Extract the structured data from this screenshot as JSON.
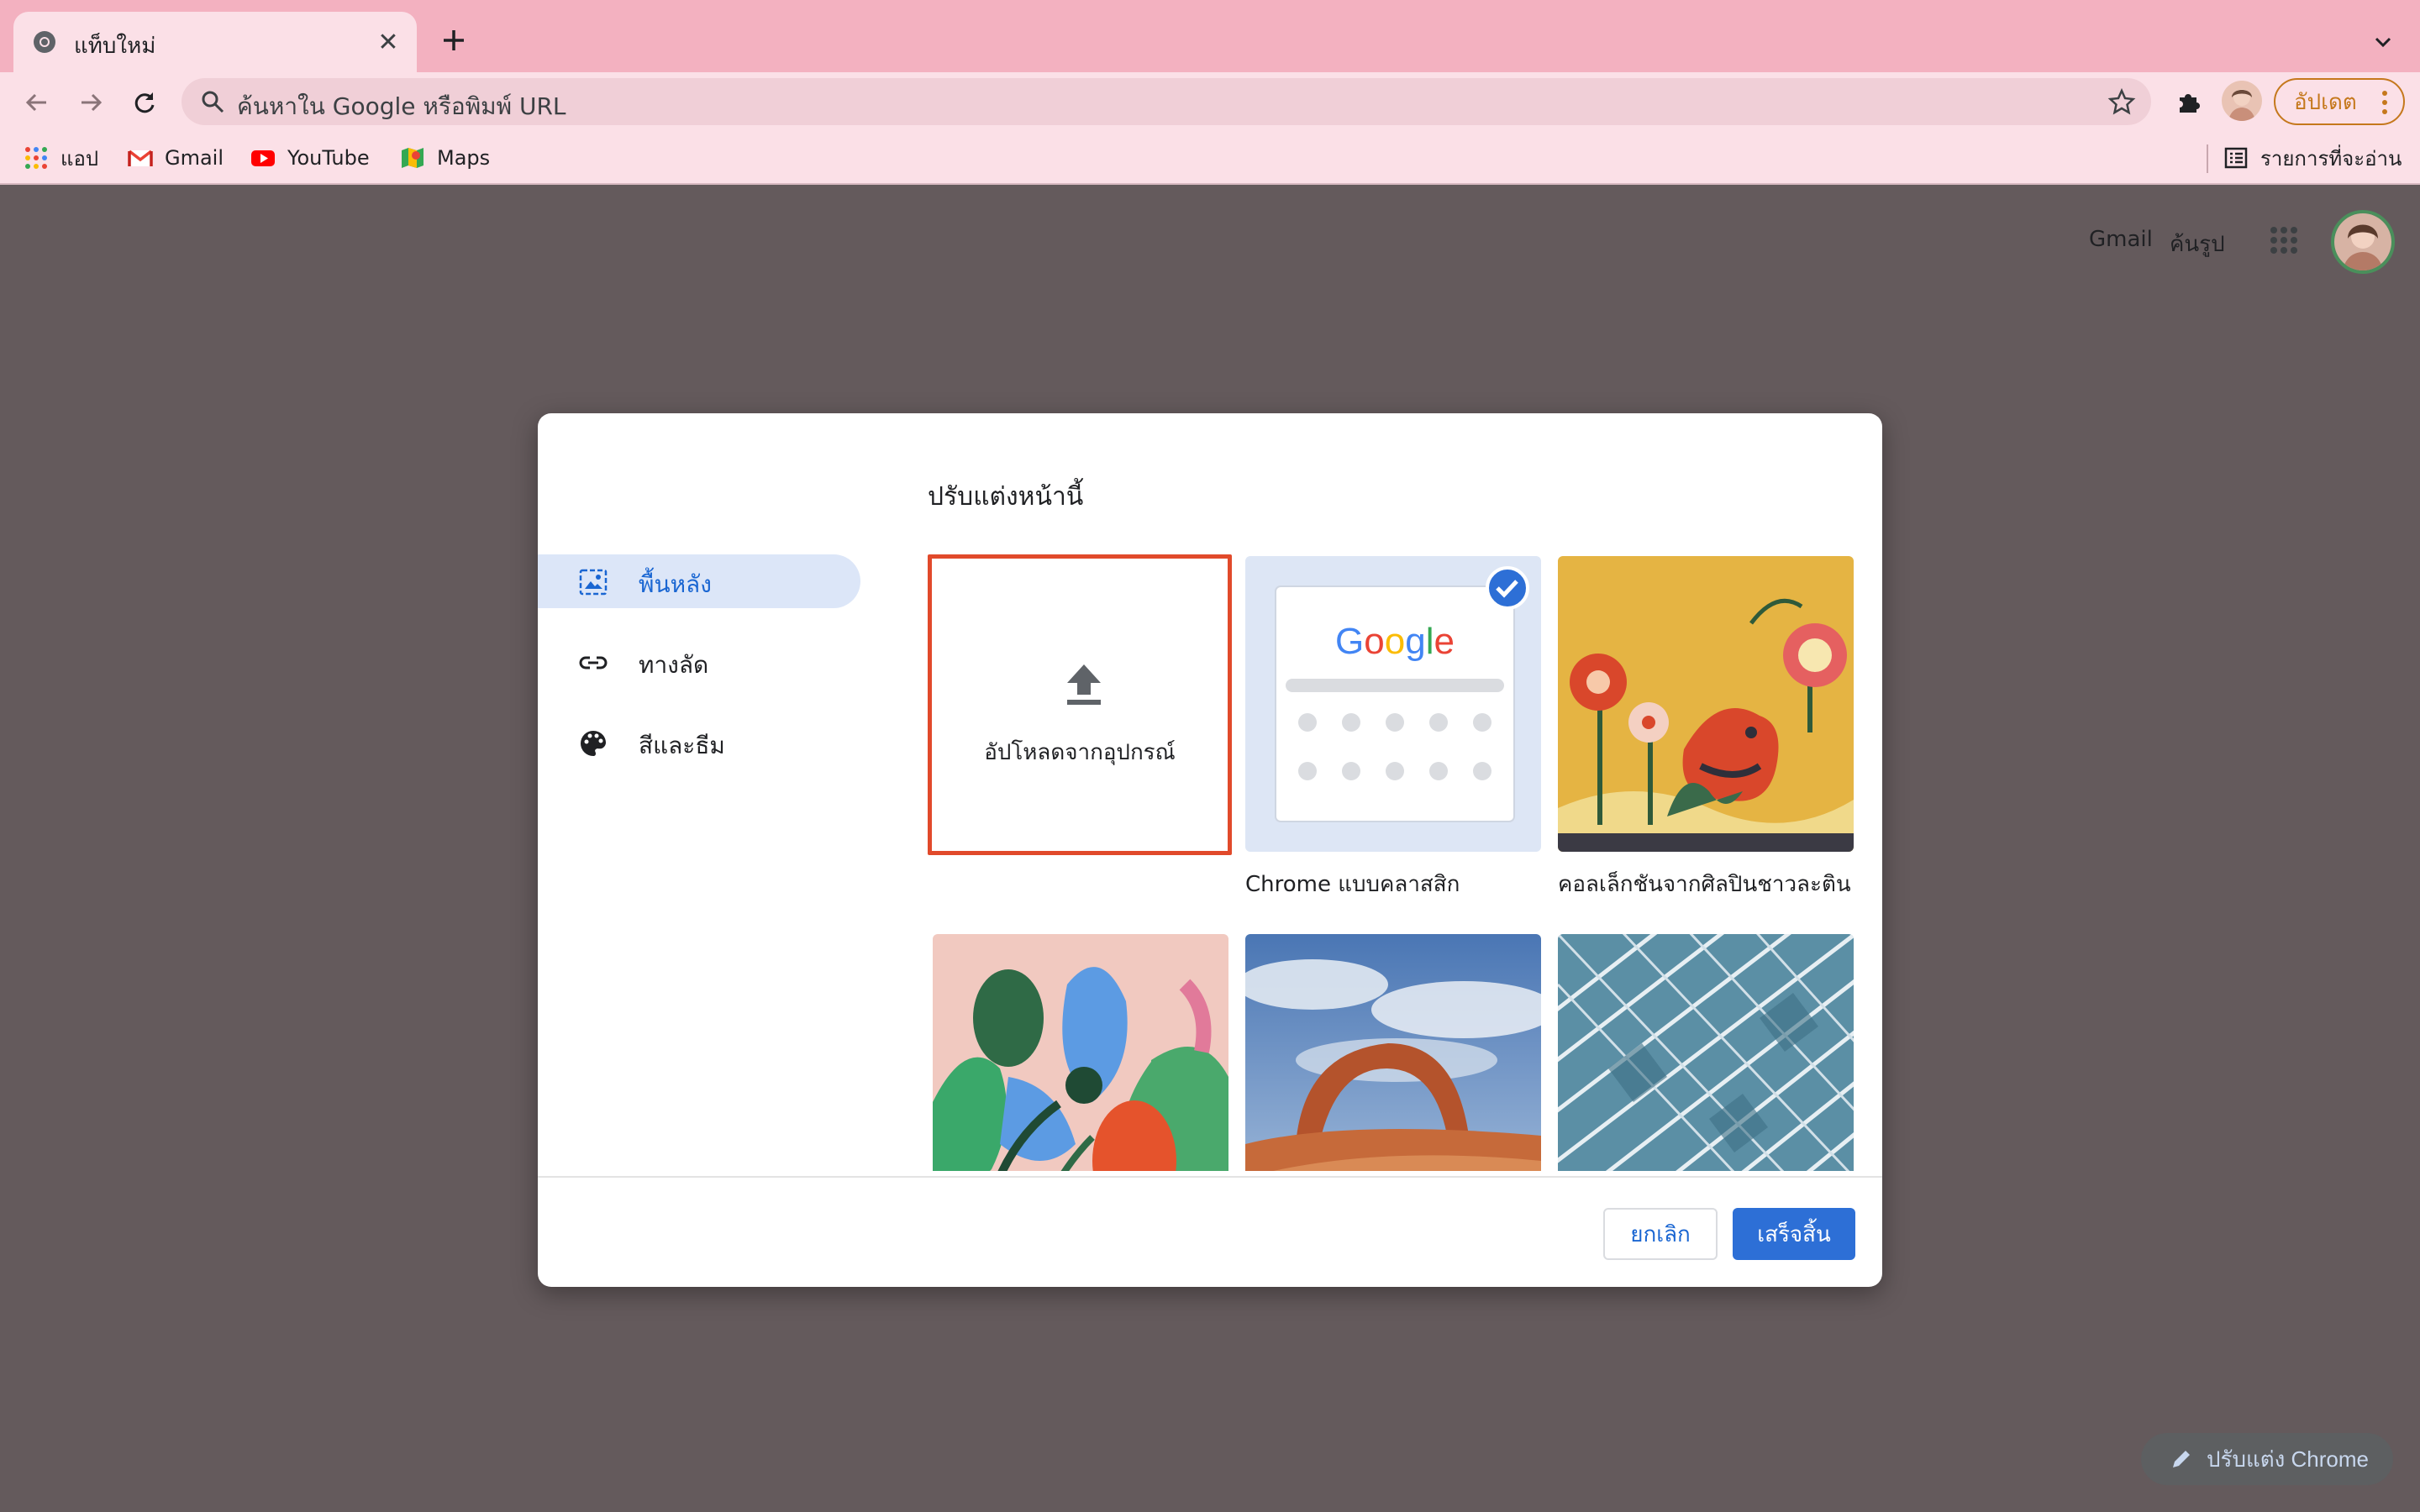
{
  "tab": {
    "title": "แท็บใหม่",
    "close_glyph": "✕"
  },
  "omnibox": {
    "placeholder": "ค้นหาใน Google หรือพิมพ์ URL"
  },
  "toolbar": {
    "update_label": "อัปเดต"
  },
  "bookmarks": [
    {
      "label": "แอป",
      "icon": "apps-grid-icon"
    },
    {
      "label": "Gmail",
      "icon": "gmail-icon"
    },
    {
      "label": "YouTube",
      "icon": "youtube-icon"
    },
    {
      "label": "Maps",
      "icon": "maps-icon"
    }
  ],
  "reading_list_label": "รายการที่จะอ่าน",
  "ntp": {
    "gmail": "Gmail",
    "images": "ค้นรูป"
  },
  "dialog": {
    "title": "ปรับแต่งหน้านี้",
    "nav": [
      {
        "label": "พื้นหลัง",
        "icon": "background-image-icon",
        "active": true
      },
      {
        "label": "ทางลัด",
        "icon": "link-icon",
        "active": false
      },
      {
        "label": "สีและธีม",
        "icon": "palette-icon",
        "active": false
      }
    ],
    "upload_label": "อัปโหลดจากอุปกรณ์",
    "classic_caption": "Chrome แบบคลาสสิก",
    "latino_caption": "คอลเล็กชันจากศิลปินชาวละติน",
    "classic_logo": "Google",
    "cancel_label": "ยกเลิก",
    "done_label": "เสร็จสิ้น"
  },
  "customize_chrome_label": "ปรับแต่ง Chrome",
  "colors": {
    "tabstrip": "#f3b1c0",
    "toolbar": "#fbe0e7",
    "page_bg": "#645a5c",
    "accent_blue": "#2d6fd6",
    "upload_border": "#e14a2b",
    "update_orange": "#c5781c"
  }
}
